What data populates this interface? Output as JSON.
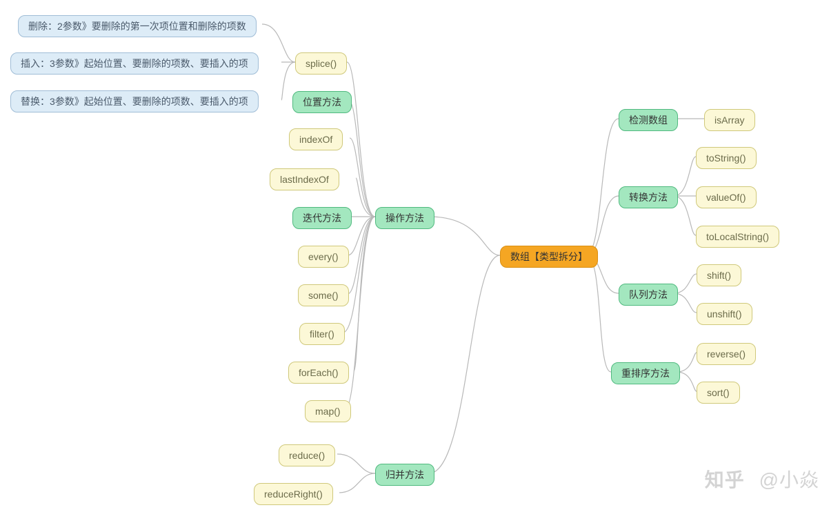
{
  "watermark": {
    "site": "知乎",
    "author": "@小焱"
  },
  "root": {
    "label": "数组【类型拆分】"
  },
  "right": {
    "detect": {
      "label": "检测数组",
      "children": [
        "isArray"
      ]
    },
    "convert": {
      "label": "转换方法",
      "children": [
        "toString()",
        "valueOf()",
        "toLocalString()"
      ]
    },
    "queue": {
      "label": "队列方法",
      "children": [
        "shift()",
        "unshift()"
      ]
    },
    "reorder": {
      "label": "重排序方法",
      "children": [
        "reverse()",
        "sort()"
      ]
    }
  },
  "left": {
    "operate": {
      "label": "操作方法",
      "splice": {
        "label": "splice()",
        "notes": [
          "删除：2参数》要删除的第一次项位置和删除的项数",
          "插入：3参数》起始位置、要删除的项数、要插入的项",
          "替换：3参数》起始位置、要删除的项数、要插入的项"
        ]
      },
      "position": {
        "label": "位置方法",
        "children": [
          "indexOf",
          "lastIndexOf"
        ]
      },
      "iterate": {
        "label": "迭代方法",
        "children": [
          "every()",
          "some()",
          "filter()",
          "forEach()",
          "map()"
        ]
      },
      "merge": {
        "label": "归并方法",
        "children": [
          "reduce()",
          "reduceRight()"
        ]
      }
    }
  }
}
